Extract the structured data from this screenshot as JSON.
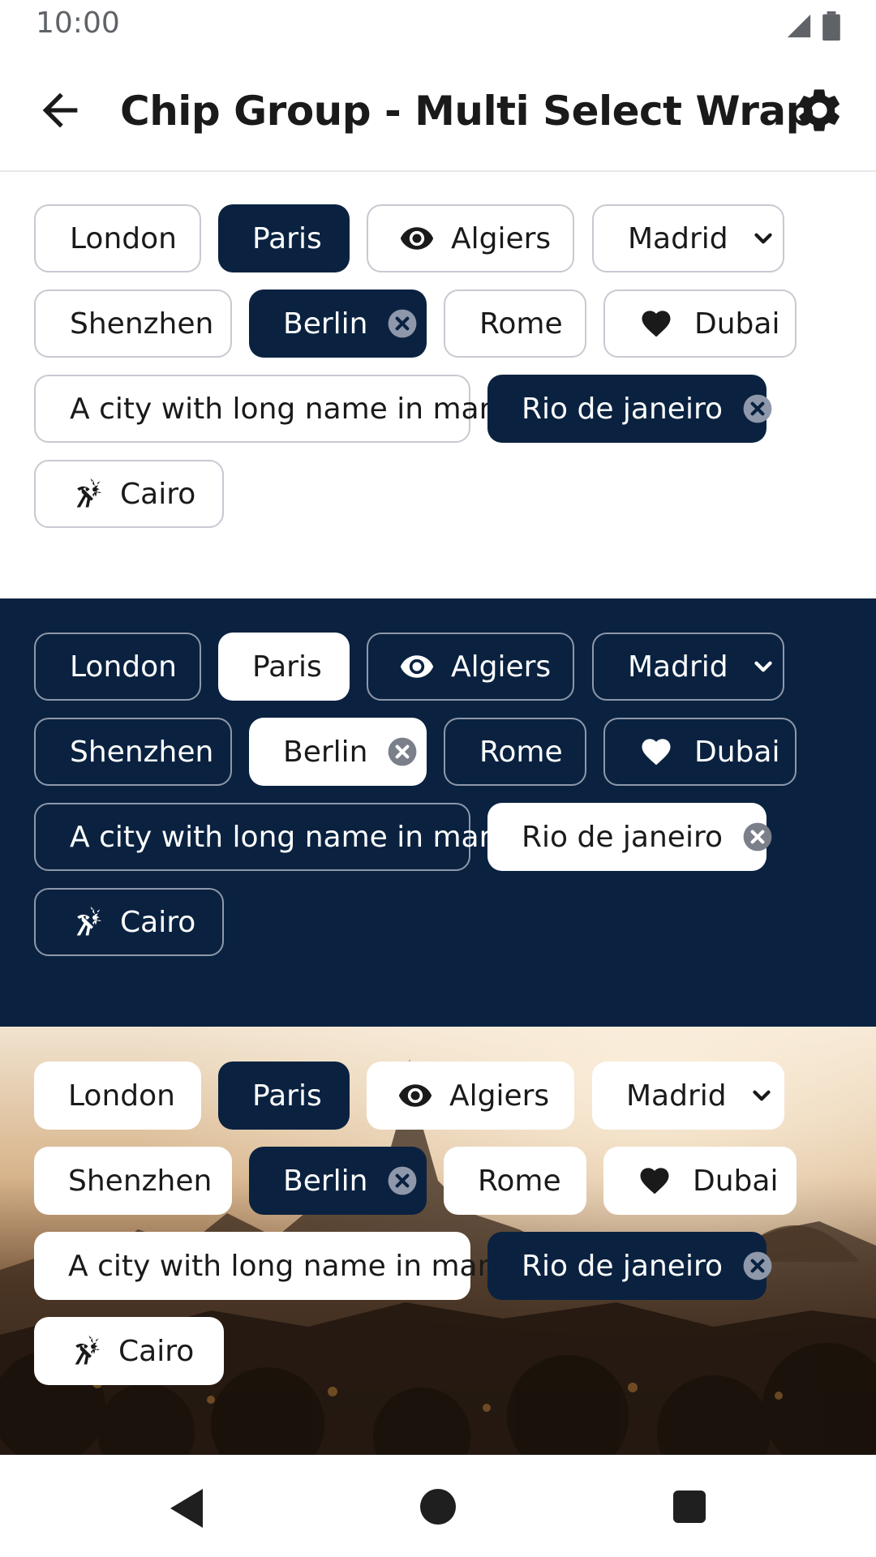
{
  "status": {
    "time": "10:00"
  },
  "app_bar": {
    "title": "Chip Group - Multi Select Wrap"
  },
  "chips": {
    "london": "London",
    "paris": "Paris",
    "algiers": "Algiers",
    "madrid": "Madrid",
    "shenzhen": "Shenzhen",
    "berlin": "Berlin",
    "rome": "Rome",
    "dubai": "Dubai",
    "long_city": "A city with long name in mars",
    "rio": "Rio de janeiro",
    "cairo": "Cairo"
  },
  "selected": [
    "Paris",
    "Berlin",
    "Rio de janeiro"
  ],
  "colors": {
    "navy": "#0a2240",
    "outline": "#c8c9d1",
    "white": "#ffffff"
  },
  "icons": {
    "algiers": "eye-icon",
    "madrid": "chevron-down-icon",
    "berlin": "clear-icon",
    "dubai": "heart-icon",
    "rio": "clear-icon",
    "cairo": "beach-icon"
  }
}
